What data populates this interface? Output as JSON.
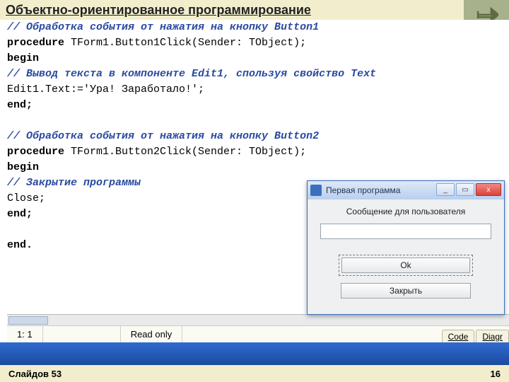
{
  "header": {
    "title": "Объектно-ориентированное программирование"
  },
  "code": {
    "l1": "// Обработка события от нажатия на кнопку Button1",
    "l2a": "procedure",
    "l2b": " TForm1.Button1Click(Sender: TObject);",
    "l3": "begin",
    "l4": "// Вывод текста в компоненте Edit1, спользуя свойство Text",
    "l5": "Edit1.Text:='Ура! Заработало!';",
    "l6": "end;",
    "l7": "",
    "l8": "// Обработка события от нажатия на кнопку Button2",
    "l9a": "procedure",
    "l9b": " TForm1.Button2Click(Sender: TObject);",
    "l10": "begin",
    "l11": "// Закрытие программы",
    "l12": "Close;",
    "l13": "end;",
    "l14": "",
    "l15": "end."
  },
  "status": {
    "pos": "1: 1",
    "mode": "Read only",
    "tabs": [
      "Code",
      "Diagr"
    ]
  },
  "dialog": {
    "title": "Первая программа",
    "message": "Сообщение для пользователя",
    "ok": "Ok",
    "close": "Закрыть"
  },
  "footer": {
    "left": "Слайдов 53",
    "right": "16"
  }
}
